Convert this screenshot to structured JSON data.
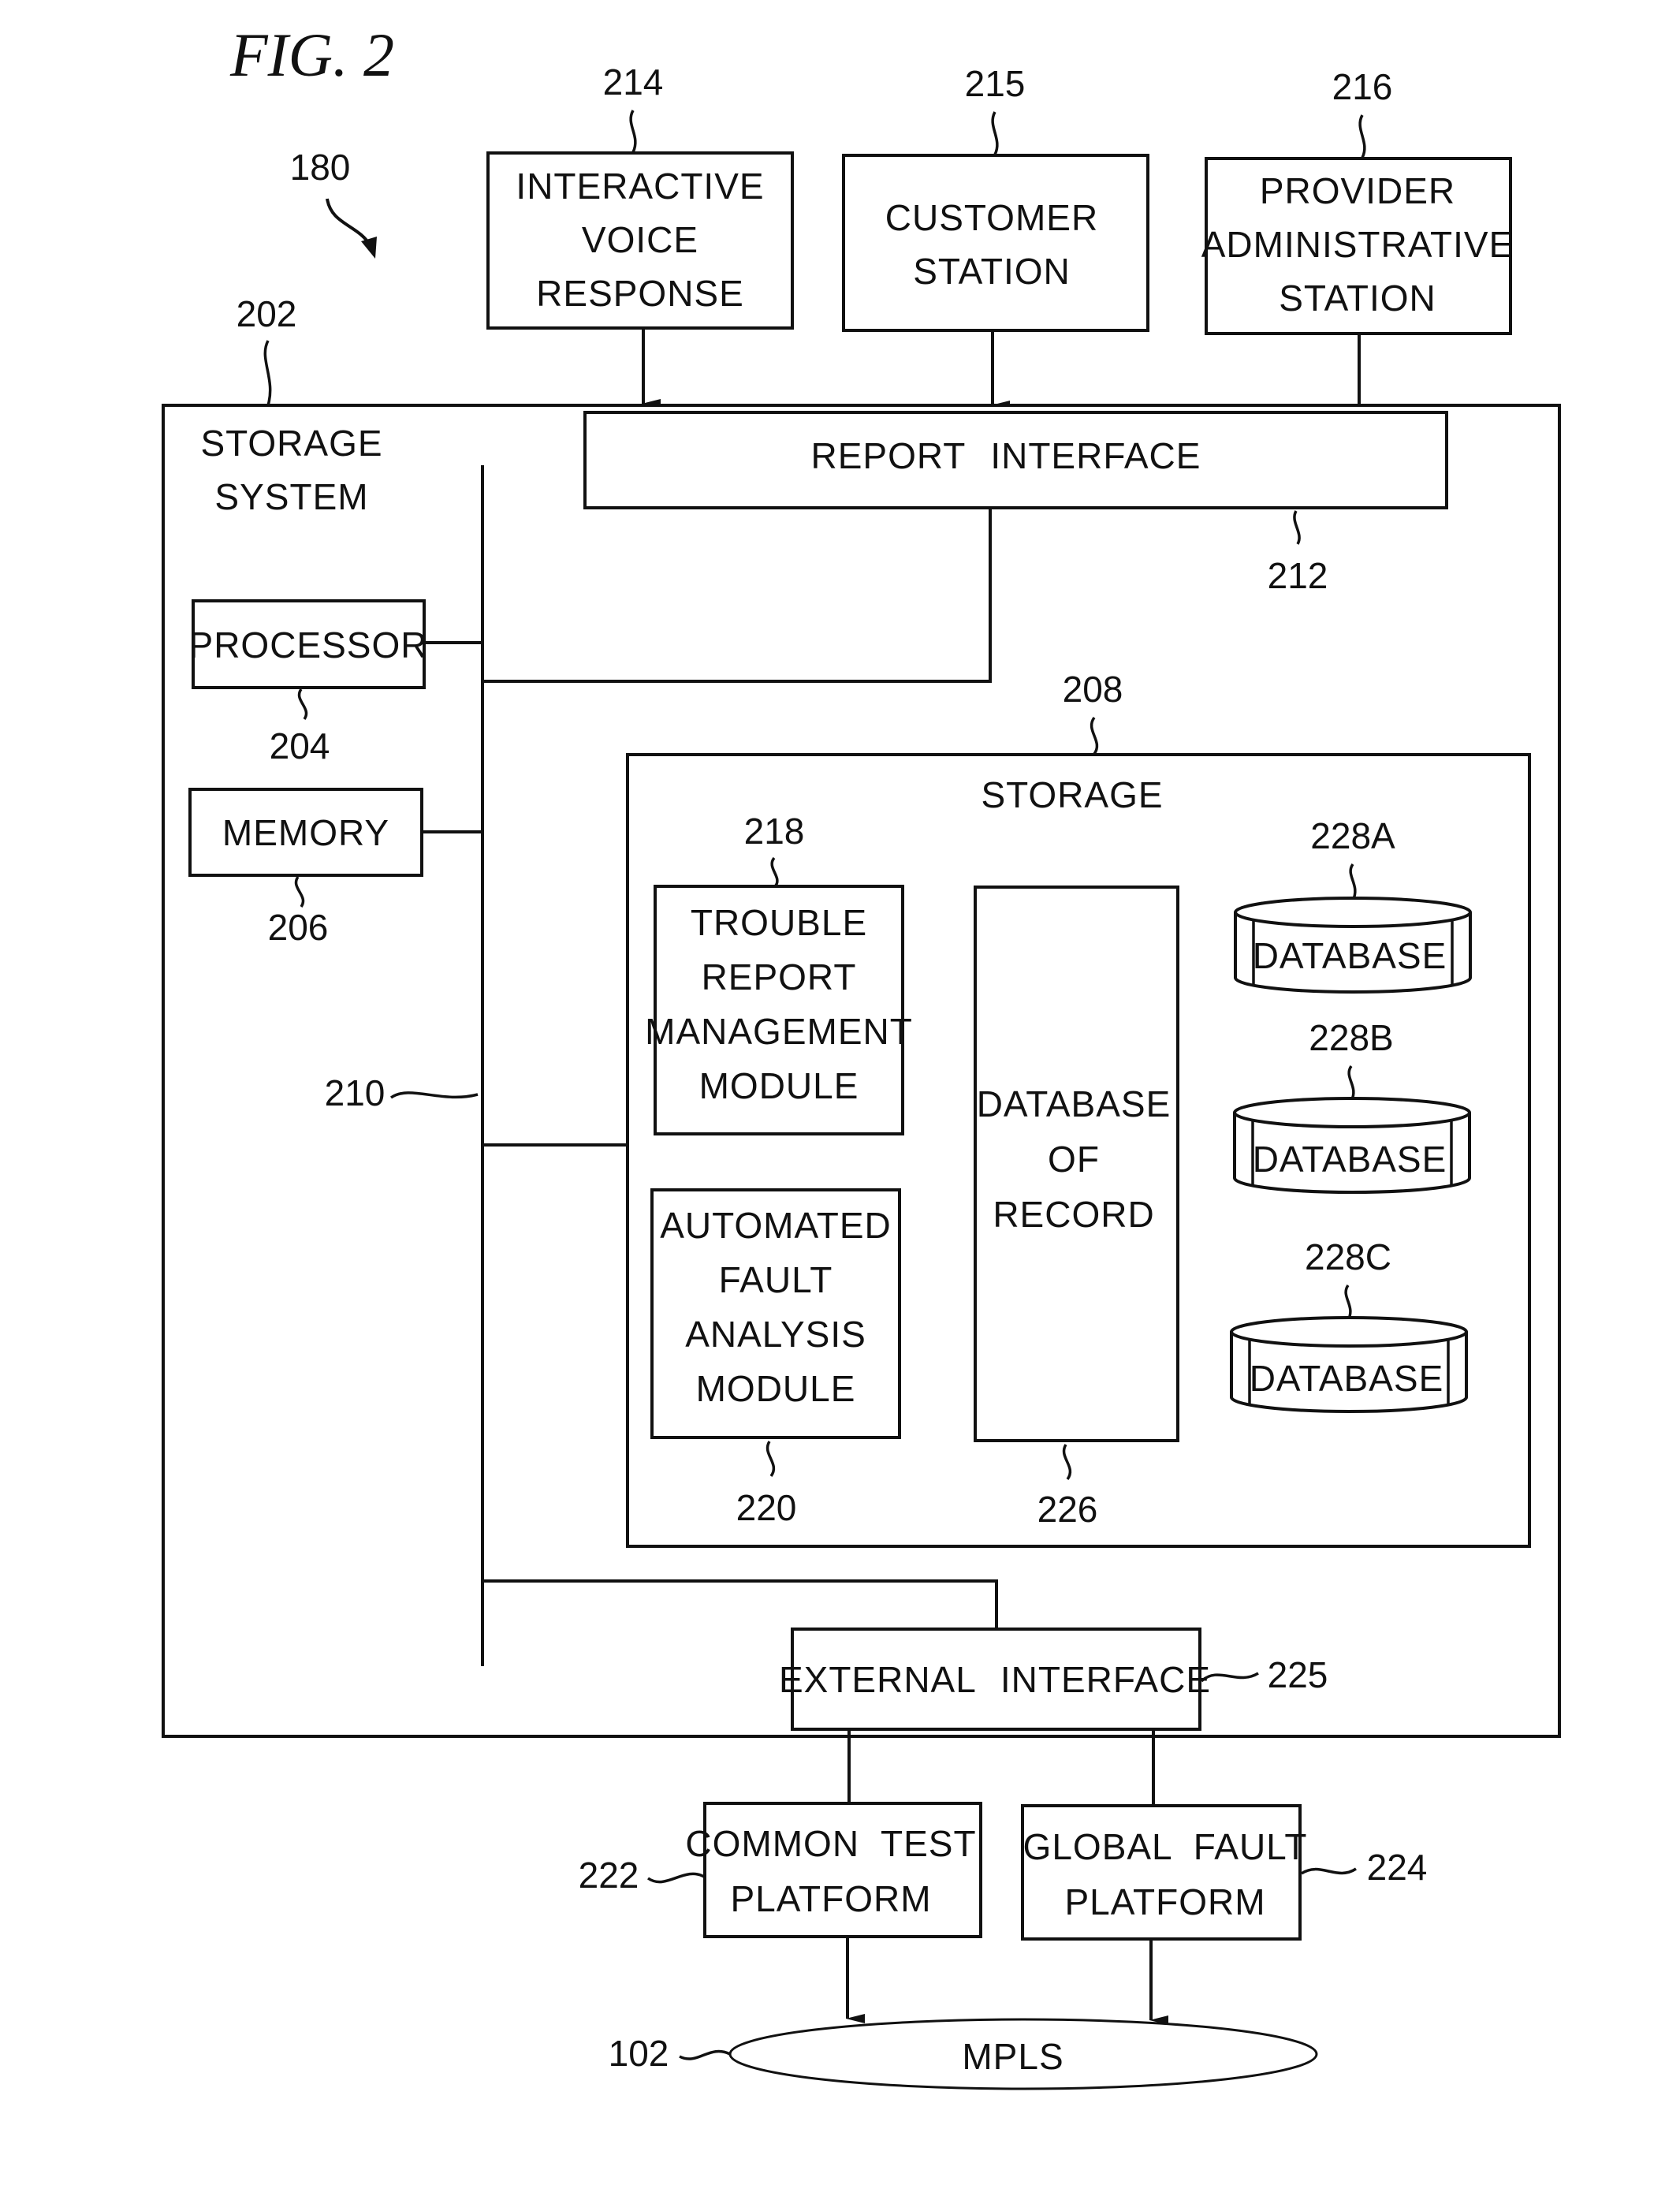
{
  "figure": {
    "title": "FIG. 2",
    "system_ref": "180"
  },
  "external_sources": [
    {
      "ref": "214",
      "lines": [
        "INTERACTIVE",
        "VOICE",
        "RESPONSE"
      ]
    },
    {
      "ref": "215",
      "lines": [
        "CUSTOMER",
        "STATION"
      ]
    },
    {
      "ref": "216",
      "lines": [
        "PROVIDER",
        "ADMINISTRATIVE",
        "STATION"
      ]
    }
  ],
  "storage_system": {
    "ref": "202",
    "lines": [
      "STORAGE",
      "SYSTEM"
    ],
    "report_interface": {
      "ref": "212",
      "label": "REPORT INTERFACE"
    },
    "bus": {
      "ref": "210"
    },
    "processor": {
      "ref": "204",
      "label": "PROCESSOR"
    },
    "memory": {
      "ref": "206",
      "label": "MEMORY"
    },
    "storage": {
      "ref": "208",
      "label": "STORAGE",
      "trouble_module": {
        "ref": "218",
        "lines": [
          "TROUBLE",
          "REPORT",
          "MANAGEMENT",
          "MODULE"
        ]
      },
      "fault_module": {
        "ref": "220",
        "lines": [
          "AUTOMATED",
          "FAULT",
          "ANALYSIS",
          "MODULE"
        ]
      },
      "db_of_record": {
        "ref": "226",
        "lines": [
          "DATABASE",
          "OF",
          "RECORD"
        ]
      },
      "databases": [
        {
          "ref": "228A",
          "label": "DATABASE"
        },
        {
          "ref": "228B",
          "label": "DATABASE"
        },
        {
          "ref": "228C",
          "label": "DATABASE"
        }
      ]
    },
    "external_interface": {
      "ref": "225",
      "label": "EXTERNAL INTERFACE"
    }
  },
  "platforms": [
    {
      "ref": "222",
      "lines": [
        "COMMON TEST",
        "PLATFORM"
      ]
    },
    {
      "ref": "224",
      "lines": [
        "GLOBAL FAULT",
        "PLATFORM"
      ]
    }
  ],
  "network": {
    "ref": "102",
    "label": "MPLS"
  }
}
